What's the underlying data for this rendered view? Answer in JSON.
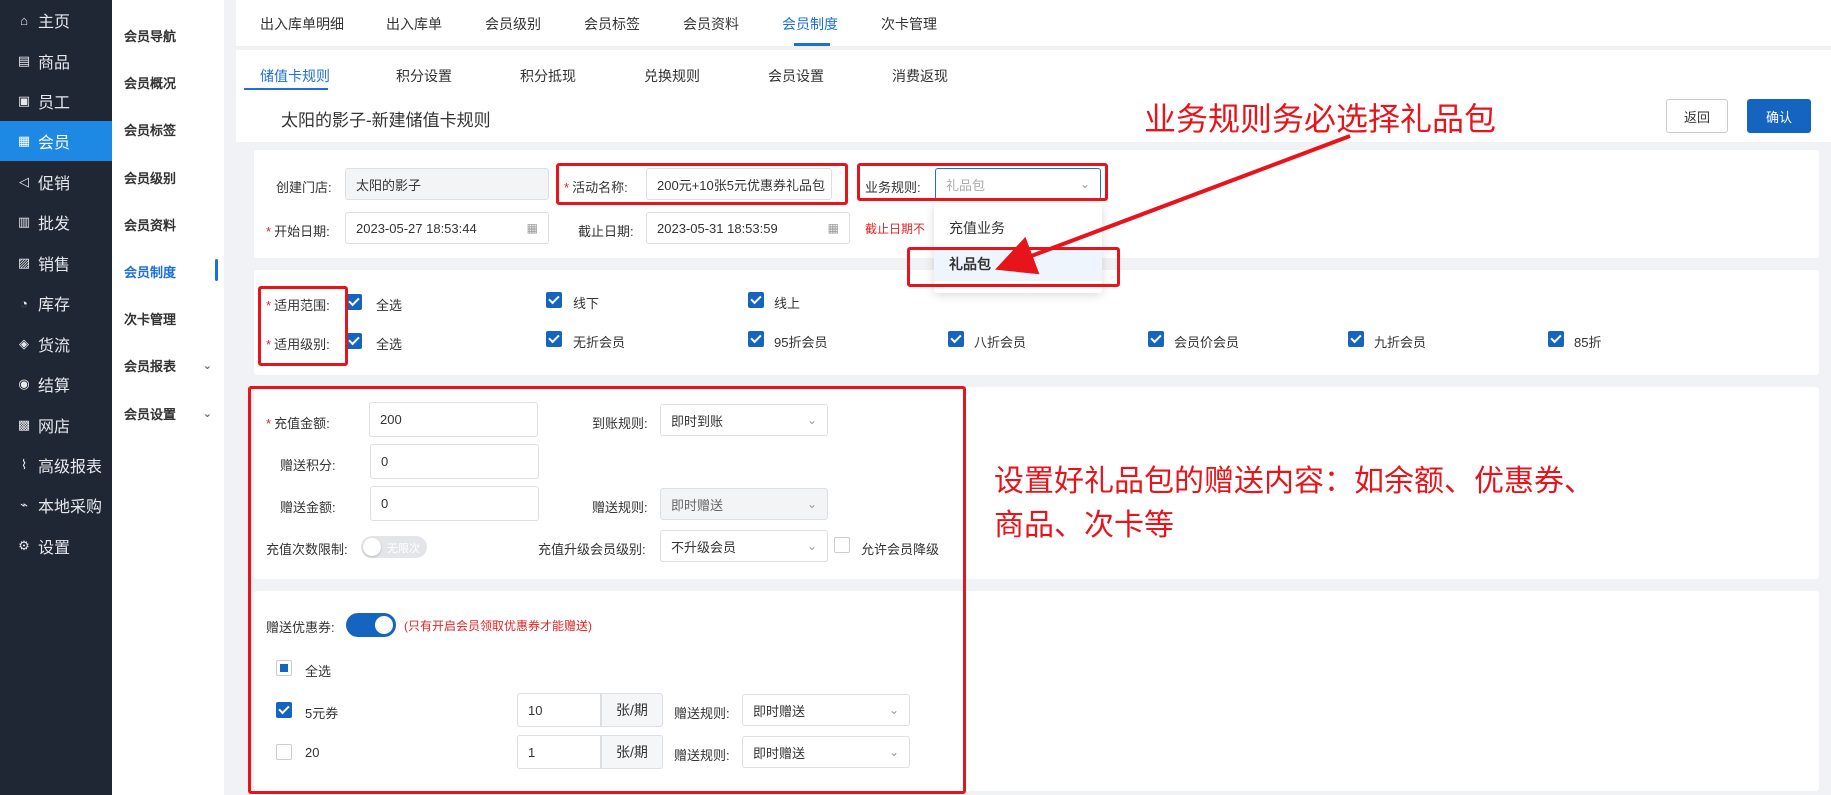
{
  "sidebar": {
    "items": [
      {
        "label": "主页",
        "icon": "home-icon",
        "glyph": "⌂"
      },
      {
        "label": "商品",
        "icon": "grid-icon",
        "glyph": "▤"
      },
      {
        "label": "员工",
        "icon": "staff-icon",
        "glyph": "▣"
      },
      {
        "label": "会员",
        "icon": "member-icon",
        "glyph": "▦"
      },
      {
        "label": "促销",
        "icon": "promo-icon",
        "glyph": "◁"
      },
      {
        "label": "批发",
        "icon": "wholesale-icon",
        "glyph": "▥"
      },
      {
        "label": "销售",
        "icon": "sales-icon",
        "glyph": "▨"
      },
      {
        "label": "库存",
        "icon": "stock-icon",
        "glyph": "◔"
      },
      {
        "label": "货流",
        "icon": "flow-icon",
        "glyph": "◈"
      },
      {
        "label": "结算",
        "icon": "settle-icon",
        "glyph": "◉"
      },
      {
        "label": "网店",
        "icon": "shop-icon",
        "glyph": "▩"
      },
      {
        "label": "高级报表",
        "icon": "report-icon",
        "glyph": "⌇"
      },
      {
        "label": "本地采购",
        "icon": "purchase-icon",
        "glyph": "⌁"
      },
      {
        "label": "设置",
        "icon": "gear-icon",
        "glyph": "⚙"
      }
    ]
  },
  "subnav": {
    "items": [
      "会员导航",
      "会员概况",
      "会员标签",
      "会员级别",
      "会员资料",
      "会员制度",
      "次卡管理",
      "会员报表",
      "会员设置"
    ]
  },
  "top_tabs": [
    "出入库单明细",
    "出入库单",
    "会员级别",
    "会员标签",
    "会员资料",
    "会员制度",
    "次卡管理"
  ],
  "sub_tabs": [
    "储值卡规则",
    "积分设置",
    "积分抵现",
    "兑换规则",
    "会员设置",
    "消费返现"
  ],
  "page": {
    "title": "太阳的影子-新建储值卡规则",
    "back_label": "返回",
    "confirm_label": "确认"
  },
  "form": {
    "store_label": "创建门店:",
    "store_value": "太阳的影子",
    "activity_label": "活动名称:",
    "activity_value": "200元+10张5元优惠券礼品包",
    "rule_label": "业务规则:",
    "rule_placeholder": "礼品包",
    "start_label": "开始日期:",
    "start_value": "2023-05-27 18:53:44",
    "end_label": "截止日期:",
    "end_value": "2023-05-31 18:53:59",
    "end_warning": "截止日期不"
  },
  "dropdown": {
    "options": [
      "充值业务",
      "礼品包"
    ]
  },
  "scope": {
    "range_label": "适用范围:",
    "range_options": [
      "全选",
      "线下",
      "线上"
    ],
    "level_label": "适用级别:",
    "level_options": [
      "全选",
      "无折会员",
      "95折会员",
      "八折会员",
      "会员价会员",
      "九折会员",
      "85折"
    ]
  },
  "recharge": {
    "amount_label": "充值金额:",
    "amount_value": "200",
    "arrival_label": "到账规则:",
    "arrival_value": "即时到账",
    "points_label": "赠送积分:",
    "points_value": "0",
    "gift_amount_label": "赠送金额:",
    "gift_amount_value": "0",
    "gift_rule_label": "赠送规则:",
    "gift_rule_value": "即时赠送",
    "limit_label": "充值次数限制:",
    "limit_switch_text": "无限次",
    "upgrade_label": "充值升级会员级别:",
    "upgrade_value": "不升级会员",
    "downgrade_label": "允许会员降级"
  },
  "coupons": {
    "label": "赠送优惠券:",
    "note": "(只有开启会员领取优惠券才能赠送)",
    "select_all": "全选",
    "rows": [
      {
        "name": "5元券",
        "checked": true,
        "qty": "10",
        "unit": "张/期",
        "rule_label": "赠送规则:",
        "rule_value": "即时赠送"
      },
      {
        "name": "20",
        "checked": false,
        "qty": "1",
        "unit": "张/期",
        "rule_label": "赠送规则:",
        "rule_value": "即时赠送"
      }
    ]
  },
  "annotations": {
    "top": "业务规则务必选择礼品包",
    "middle_line1": "设置好礼品包的赠送内容：如余额、优惠券、",
    "middle_line2": "商品、次卡等"
  },
  "colors": {
    "sidebar_bg": "#1f2634",
    "accent": "#1565c0",
    "annotation": "#e8141c"
  }
}
